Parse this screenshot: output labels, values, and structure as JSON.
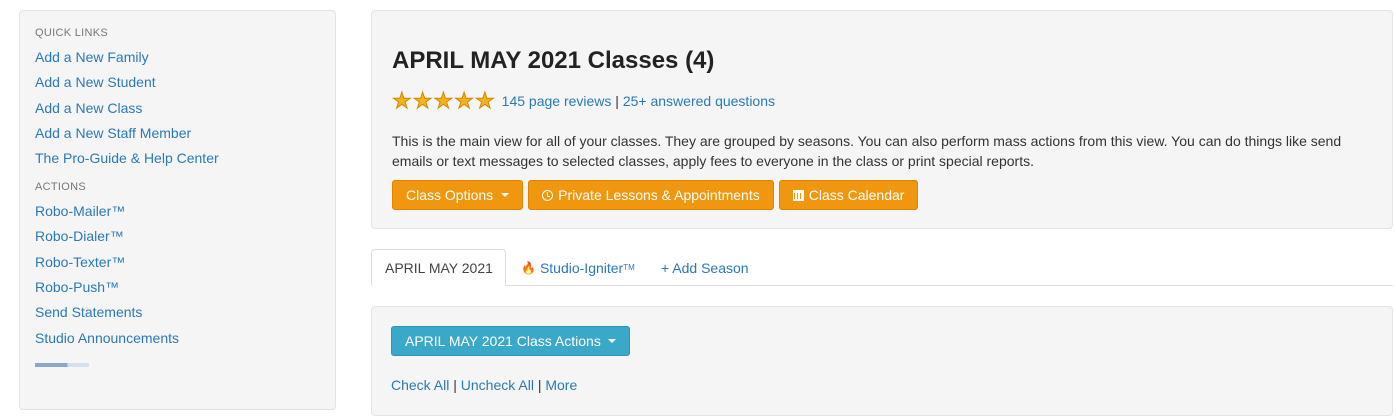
{
  "sidebar": {
    "quick_links_heading": "QUICK LINKS",
    "quick_links": [
      "Add a New Family",
      "Add a New Student",
      "Add a New Class",
      "Add a New Staff Member",
      "The Pro-Guide & Help Center"
    ],
    "actions_heading": "ACTIONS",
    "actions": [
      "Robo-Mailer™",
      "Robo-Dialer™",
      "Robo-Texter™",
      "Robo-Push™",
      "Send Statements",
      "Studio Announcements"
    ]
  },
  "header": {
    "title": "APRIL MAY 2021 Classes (4)",
    "rating_stars": 5,
    "reviews_label": "145 page reviews",
    "separator": " | ",
    "questions_label": "25+ answered questions",
    "description": "This is the main view for all of your classes. They are grouped by seasons. You can also perform mass actions from this view. You can do things like send emails or text messages to selected classes, apply fees to everyone in the class or print special reports.",
    "buttons": {
      "class_options": "Class Options",
      "private_lessons": "Private Lessons & Appointments",
      "class_calendar": "Class Calendar"
    },
    "accent_color": "#f0960f"
  },
  "tabs": {
    "active": "APRIL MAY 2021",
    "igniter": "Studio-Igniter",
    "igniter_tm": "TM",
    "add_season": "+ Add Season"
  },
  "season_panel": {
    "actions_button": "APRIL MAY 2021 Class Actions",
    "check_all": "Check All",
    "uncheck_all": "Uncheck All",
    "more": "More",
    "sep": " | "
  }
}
